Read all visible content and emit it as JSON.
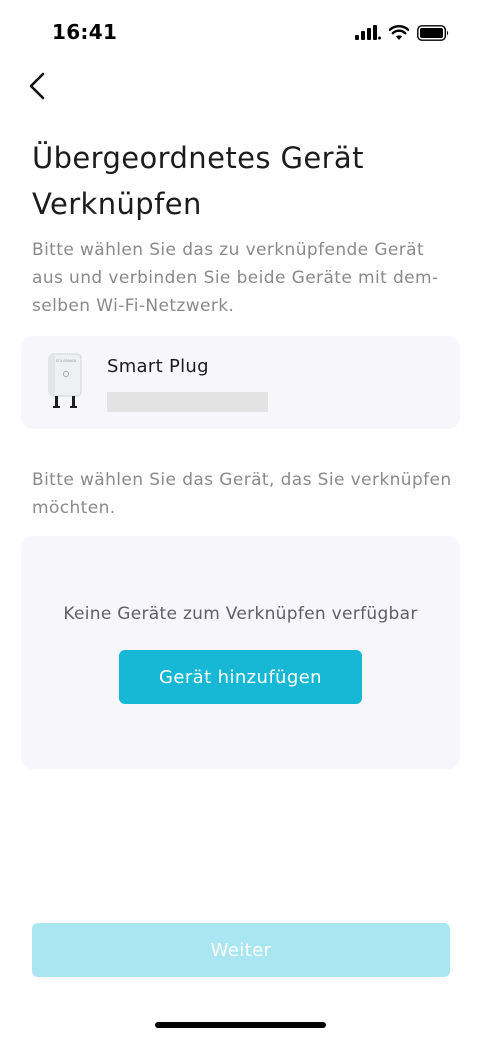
{
  "status_bar": {
    "time": "16:41",
    "icons": [
      "cellular-signal-icon",
      "wifi-icon",
      "battery-icon"
    ]
  },
  "navigation": {
    "back_icon": "chevron-left-icon"
  },
  "header": {
    "title": "Übergeordnetes Gerät Verknüpfen",
    "description": "Bitte wählen Sie das zu verknüpfende Gerät aus und verbinden Sie beide Geräte mit dem­selben Wi-Fi-Netzwerk."
  },
  "current_device": {
    "name": "Smart Plug",
    "brand_label": "SOLARMAN",
    "icon": "smart-plug-icon"
  },
  "selection": {
    "hint": "Bitte wählen Sie das Gerät, das Sie verknüp­fen möchten.",
    "empty_text": "Keine Geräte zum Verknüpfen verfügbar",
    "add_button_label": "Gerät hinzufügen"
  },
  "footer": {
    "next_label": "Weiter",
    "next_enabled": false
  },
  "colors": {
    "accent": "#17b8d6",
    "accent_disabled": "#a9e6f1",
    "card_background": "#f6f6fb",
    "secondary_text": "#8a8a8a"
  }
}
